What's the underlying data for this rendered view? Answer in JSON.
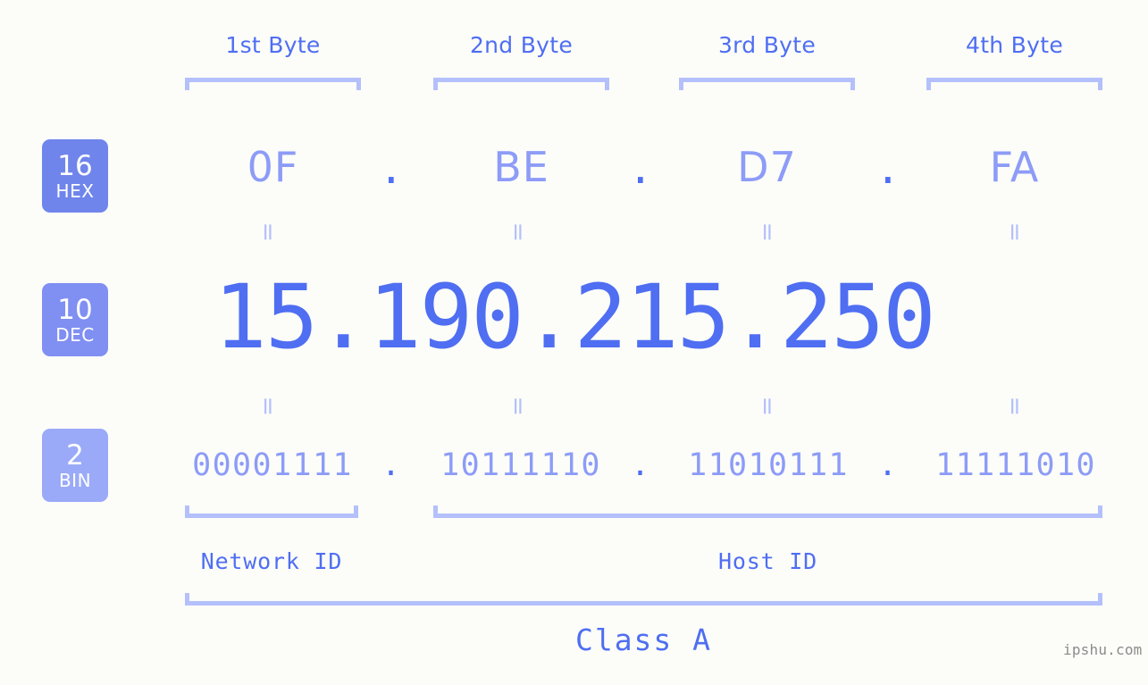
{
  "background_color": "#fcfdf9",
  "accent_color": "#4f6ef2",
  "accent_light_color": "#8d9cf7",
  "bracket_color": "#b4c0fb",
  "byte_headers": [
    {
      "label": "1st Byte"
    },
    {
      "label": "2nd Byte"
    },
    {
      "label": "3rd Byte"
    },
    {
      "label": "4th Byte"
    }
  ],
  "bases": [
    {
      "number": "16",
      "name": "HEX",
      "color": "#6f85ec"
    },
    {
      "number": "10",
      "name": "DEC",
      "color": "#808ff2"
    },
    {
      "number": "2",
      "name": "BIN",
      "color": "#9aaaf8"
    }
  ],
  "rows": {
    "hex": {
      "values": [
        "0F",
        "BE",
        "D7",
        "FA"
      ],
      "separator": "."
    },
    "dec": {
      "text": "15.190.215.250",
      "values": [
        "15",
        "190",
        "215",
        "250"
      ],
      "separator": "."
    },
    "bin": {
      "values": [
        "00001111",
        "10111110",
        "11010111",
        "11111010"
      ],
      "separator": "."
    }
  },
  "equals_marks": [
    "=",
    "=",
    "=",
    "=",
    "=",
    "=",
    "=",
    "="
  ],
  "segments": {
    "network_id": "Network ID",
    "host_id": "Host ID",
    "class": "Class A"
  },
  "watermark": "ipshu.com"
}
